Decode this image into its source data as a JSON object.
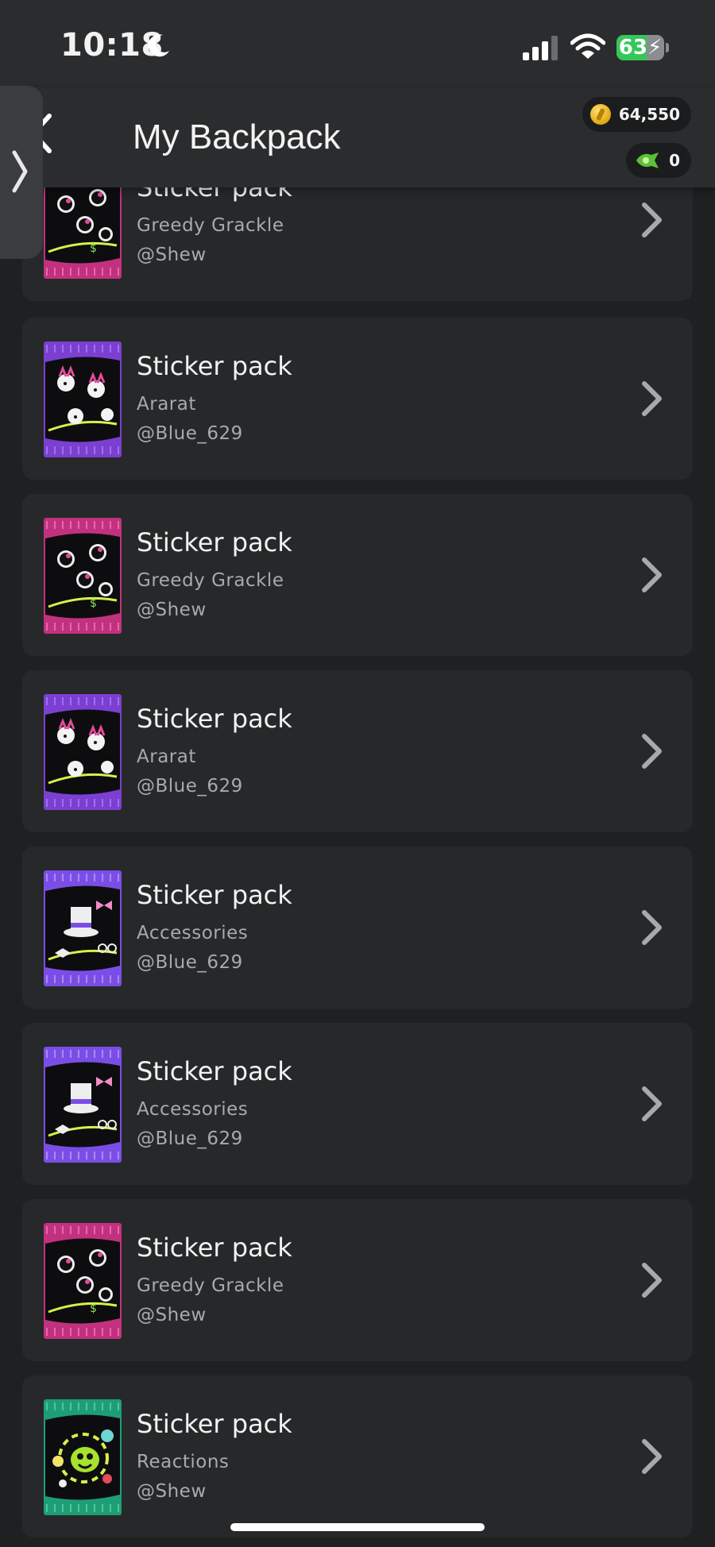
{
  "status_bar": {
    "time": "10:18",
    "battery": "63"
  },
  "header": {
    "title": "My Backpack",
    "coins": "64,550",
    "gems": "0"
  },
  "items": [
    {
      "title": "Sticker pack",
      "pack": "Greedy Grackle",
      "creator": "@Shew",
      "pack_color": "#c2317f"
    },
    {
      "title": "Sticker pack",
      "pack": "Ararat",
      "creator": "@Blue_629",
      "pack_color": "#7b3fd1"
    },
    {
      "title": "Sticker pack",
      "pack": "Greedy Grackle",
      "creator": "@Shew",
      "pack_color": "#c2317f"
    },
    {
      "title": "Sticker pack",
      "pack": "Ararat",
      "creator": "@Blue_629",
      "pack_color": "#7b3fd1"
    },
    {
      "title": "Sticker pack",
      "pack": "Accessories",
      "creator": "@Blue_629",
      "pack_color": "#7a4ee6"
    },
    {
      "title": "Sticker pack",
      "pack": "Accessories",
      "creator": "@Blue_629",
      "pack_color": "#7a4ee6"
    },
    {
      "title": "Sticker pack",
      "pack": "Greedy Grackle",
      "creator": "@Shew",
      "pack_color": "#c2317f"
    },
    {
      "title": "Sticker pack",
      "pack": "Reactions",
      "creator": "@Shew",
      "pack_color": "#1e9e74"
    }
  ],
  "colors": {
    "background": "#1f2021",
    "card": "#272829",
    "header": "#2b2c2d",
    "battery_fill": "#34c759"
  }
}
